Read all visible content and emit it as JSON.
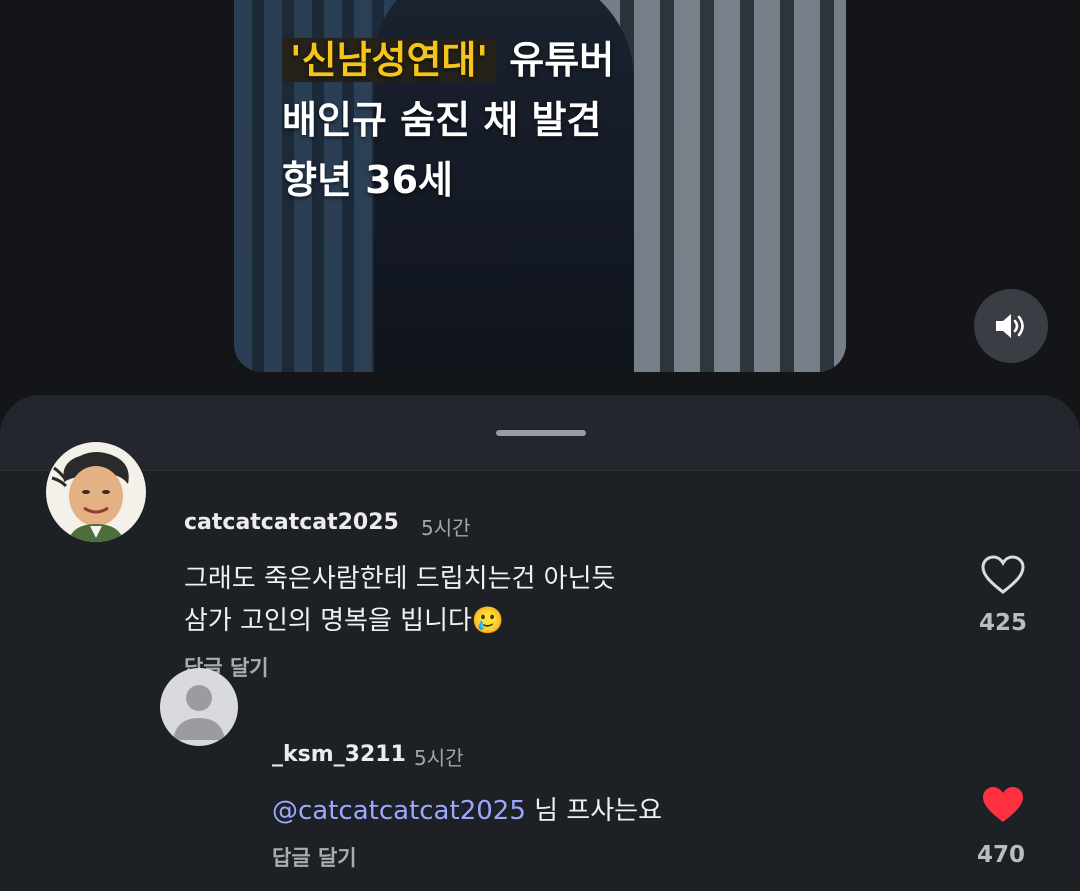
{
  "video": {
    "caption_highlight": "'신남성연대'",
    "caption_line1_rest": " 유튜버",
    "caption_line2": "배인규 숨진 채 발견",
    "caption_line3": "향년 36세"
  },
  "comments": [
    {
      "username": "catcatcatcat2025",
      "time": "5시간",
      "text_line1": "그래도 죽은사람한테  드립치는건 아닌듯",
      "text_line2": "삼가 고인의 명복을 빕니다",
      "emoji": "🥲",
      "reply_label": "답글 달기",
      "like_count": "425",
      "liked": false,
      "avatar_icon": "profile-photo-icon"
    }
  ],
  "replies": [
    {
      "username": "_ksm_3211",
      "time": "5시간",
      "mention": "@catcatcatcat2025",
      "text": " 님 프사는요",
      "reply_label": "답글 달기",
      "like_count": "470",
      "liked": true,
      "avatar_icon": "default-avatar-icon"
    }
  ],
  "colors": {
    "accent_like": "#ff3040",
    "mention": "#9aa8ff",
    "caption_highlight": "#f5c518",
    "sheet_bg": "#23262c"
  }
}
